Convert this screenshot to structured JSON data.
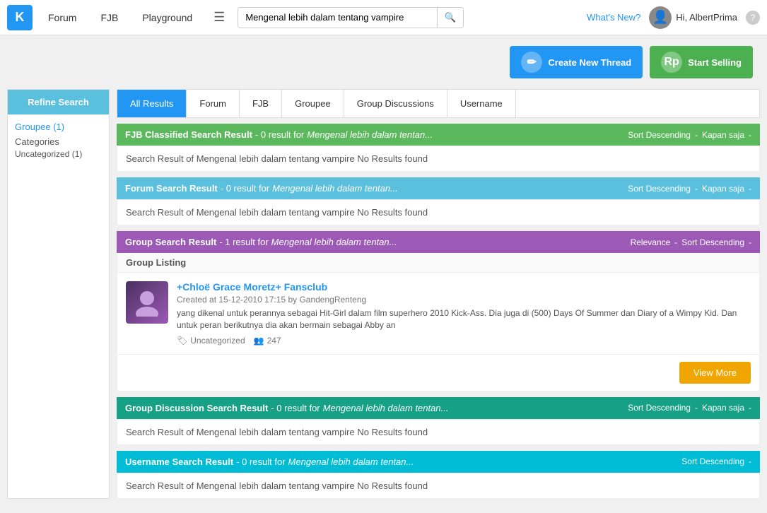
{
  "navbar": {
    "logo": "K",
    "links": [
      "Forum",
      "FJB",
      "Playground"
    ],
    "search_value": "Mengenal lebih dalam tentang vampire",
    "search_placeholder": "Mengenal lebih dalam tentang vampire",
    "whats_new": "What's New?",
    "user_greeting": "Hi, AlbertPrima",
    "help_icon": "?"
  },
  "actions": {
    "create_thread": "Create New Thread",
    "start_selling": "Start Selling",
    "create_icon": "✏",
    "sell_icon": "Rp"
  },
  "sidebar": {
    "refine_label": "Refine Search",
    "groupee_label": "Groupee (1)",
    "categories_label": "Categories",
    "uncategorized_label": "Uncategorized (1)"
  },
  "tabs": [
    {
      "label": "All Results",
      "active": true
    },
    {
      "label": "Forum",
      "active": false
    },
    {
      "label": "FJB",
      "active": false
    },
    {
      "label": "Groupee",
      "active": false
    },
    {
      "label": "Group Discussions",
      "active": false
    },
    {
      "label": "Username",
      "active": false
    }
  ],
  "fjb_result": {
    "title": "FJB Classified Search Result",
    "count": "- 0 result for",
    "query": "Mengenal lebih dalam tentan...",
    "sort_label": "Sort Descending",
    "sort_sep": "-",
    "when_label": "Kapan saja",
    "when_sep": "-",
    "body": "Search Result of Mengenal lebih dalam tentang vampire No Results found"
  },
  "forum_result": {
    "title": "Forum Search Result",
    "count": "- 0 result for",
    "query": "Mengenal lebih dalam tentan...",
    "sort_label": "Sort Descending",
    "sort_sep": "-",
    "when_label": "Kapan saja",
    "when_sep": "-",
    "body": "Search Result of Mengenal lebih dalam tentang vampire No Results found"
  },
  "group_result": {
    "title": "Group Search Result",
    "count": "- 1 result for",
    "query": "Mengenal lebih dalam tentan...",
    "relevance_label": "Relevance",
    "rel_sep": "-",
    "sort_label": "Sort Descending",
    "sort_sep": "-",
    "listing_title": "Group Listing",
    "group": {
      "name": "+Chloë Grace Moretz+ Fansclub",
      "meta": "Created at 15-12-2010 17:15 by GandengRenteng",
      "desc": "yang dikenal untuk perannya sebagai Hit-Girl dalam film superhero 2010 Kick-Ass. Dia juga di (500) Days Of Summer dan Diary of a Wimpy Kid. Dan untuk peran berikutnya dia akan bermain sebagai Abby an",
      "tag": "Uncategorized",
      "members": "247"
    }
  },
  "view_more": {
    "label": "View More"
  },
  "group_discussion_result": {
    "title": "Group Discussion Search Result",
    "count": "- 0 result for",
    "query": "Mengenal lebih dalam tentan...",
    "sort_label": "Sort Descending",
    "sort_sep": "-",
    "when_label": "Kapan saja",
    "when_sep": "-",
    "body": "Search Result of Mengenal lebih dalam tentang vampire No Results found"
  },
  "username_result": {
    "title": "Username Search Result",
    "count": "- 0 result for",
    "query": "Mengenal lebih dalam tentan...",
    "sort_label": "Sort Descending",
    "sort_sep": "-",
    "body": "Search Result of Mengenal lebih dalam tentang vampire No Results found"
  }
}
